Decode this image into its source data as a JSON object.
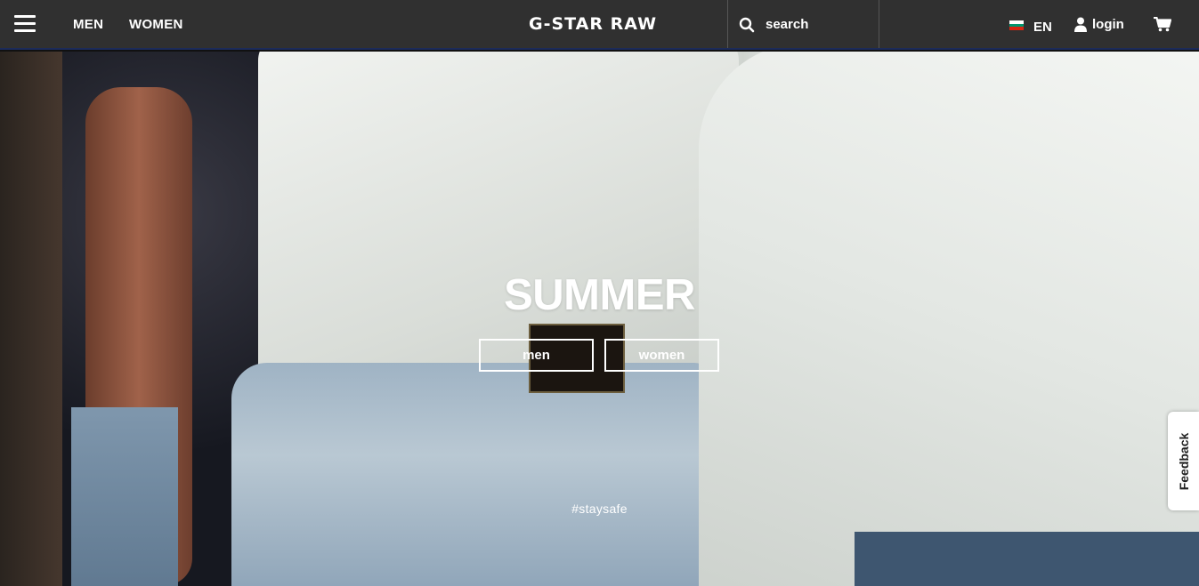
{
  "header": {
    "menu_icon": "hamburger-icon",
    "nav": [
      {
        "label": "MEN"
      },
      {
        "label": "WOMEN"
      }
    ],
    "logo": "G-STAR RAW",
    "search": {
      "label": "search",
      "icon": "search-icon"
    },
    "language": {
      "label": "EN",
      "flag_colors": [
        "#ffffff",
        "#00966e",
        "#d62612"
      ]
    },
    "login": {
      "label": "login",
      "icon": "user-icon"
    },
    "cart": {
      "icon": "cart-icon"
    }
  },
  "hero": {
    "title": "SUMMER",
    "buttons": [
      {
        "label": "men"
      },
      {
        "label": "women"
      }
    ],
    "tagline": "#staysafe"
  },
  "feedback_tab": {
    "label": "Feedback"
  },
  "colors": {
    "header_bg": "#303030",
    "header_accent": "#1c2b5a",
    "text": "#ffffff"
  }
}
